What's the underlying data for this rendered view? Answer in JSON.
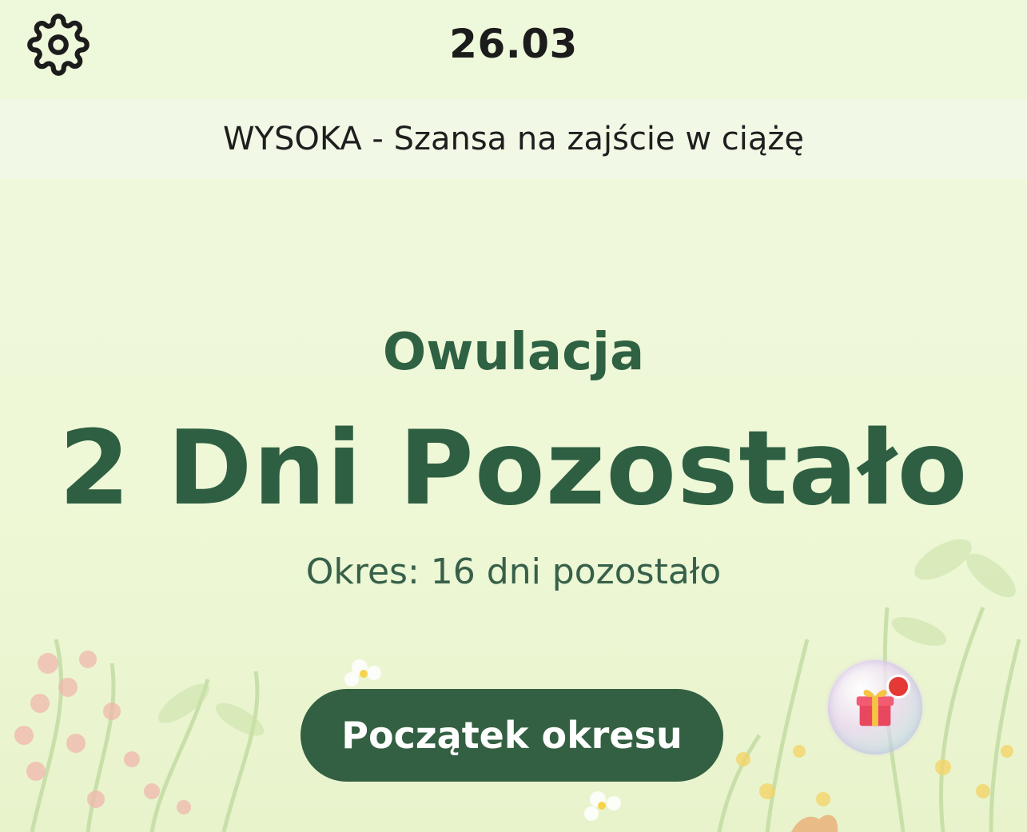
{
  "header": {
    "date": "26.03",
    "settings_icon": "gear-icon"
  },
  "status_bar": {
    "chance_text": "WYSOKA - Szansa na zajście w ciążę"
  },
  "main": {
    "phase": "Owulacja",
    "days_left": "2 Dni Pozostało",
    "period_info": "Okres: 16 dni pozostało"
  },
  "actions": {
    "start_period_label": "Początek okresu",
    "gift_icon": "gift-icon"
  },
  "colors": {
    "background": "#eef8d9",
    "accent": "#336042",
    "title_text": "#2f6143",
    "badge": "#e53935"
  }
}
